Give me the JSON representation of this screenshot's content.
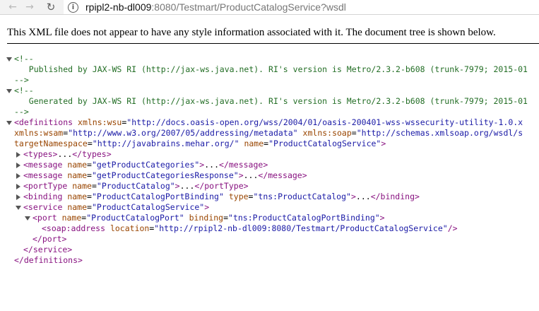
{
  "browser": {
    "back_icon": "arrow-left-icon",
    "forward_icon": "arrow-right-icon",
    "reload_icon": "reload-icon",
    "info_icon": "info-icon",
    "url_host": "rpipl2-nb-dl009",
    "url_rest": ":8080/Testmart/ProductCatalogService?wsdl"
  },
  "notice": "This XML file does not appear to have any style information associated with it. The document tree is shown below.",
  "xml": {
    "comment1_open": "<!--",
    "comment1_text": "   Published by JAX-WS RI (http://jax-ws.java.net). RI's version is Metro/2.3.2-b608 (trunk-7979; 2015-01",
    "comment1_close": "-->",
    "comment2_open": "<!--",
    "comment2_text": "   Generated by JAX-WS RI (http://jax-ws.java.net). RI's version is Metro/2.3.2-b608 (trunk-7979; 2015-01",
    "comment2_close": "-->",
    "definitions": {
      "tag_open": "<definitions",
      "attr_wsu": "xmlns:wsu",
      "val_wsu": "\"http://docs.oasis-open.org/wss/2004/01/oasis-200401-wss-wssecurity-utility-1.0.x",
      "attr_wsam": "xmlns:wsam",
      "val_wsam": "\"http://www.w3.org/2007/05/addressing/metadata\"",
      "attr_soap": "xmlns:soap",
      "val_soap": "\"http://schemas.xmlsoap.org/wsdl/s",
      "attr_tns": "targetNamespace",
      "val_tns": "\"http://javabrains.mehar.org/\"",
      "attr_name": "name",
      "val_name": "\"ProductCatalogService\"",
      "tag_close": "</definitions>"
    },
    "types": {
      "open": "<types>",
      "ellipsis": "...",
      "close": "</types>"
    },
    "message1": {
      "tag": "<message",
      "attr": "name",
      "val": "\"getProductCategories\"",
      "gt": ">",
      "ellipsis": "...",
      "close": "</message>"
    },
    "message2": {
      "tag": "<message",
      "attr": "name",
      "val": "\"getProductCategoriesResponse\"",
      "gt": ">",
      "ellipsis": "...",
      "close": "</message>"
    },
    "portType": {
      "tag": "<portType",
      "attr": "name",
      "val": "\"ProductCatalog\"",
      "gt": ">",
      "ellipsis": "...",
      "close": "</portType>"
    },
    "binding": {
      "tag": "<binding",
      "attr1": "name",
      "val1": "\"ProductCatalogPortBinding\"",
      "attr2": "type",
      "val2": "\"tns:ProductCatalog\"",
      "gt": ">",
      "ellipsis": "...",
      "close": "</binding>"
    },
    "service": {
      "tag": "<service",
      "attr": "name",
      "val": "\"ProductCatalogService\"",
      "gt": ">",
      "close": "</service>"
    },
    "port": {
      "tag": "<port",
      "attr1": "name",
      "val1": "\"ProductCatalogPort\"",
      "attr2": "binding",
      "val2": "\"tns:ProductCatalogPortBinding\"",
      "gt": ">",
      "close": "</port>"
    },
    "address": {
      "tag": "<soap:address",
      "attr": "location",
      "val": "\"http://rpipl2-nb-dl009:8080/Testmart/ProductCatalogService\"",
      "end": "/>"
    }
  }
}
